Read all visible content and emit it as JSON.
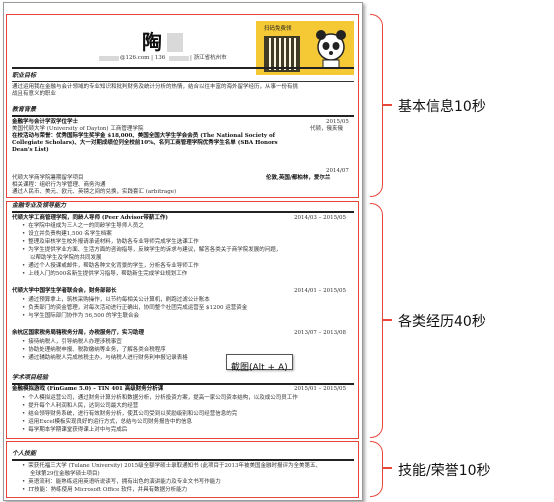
{
  "resume": {
    "name": "陶",
    "contact": "@126.com | 136",
    "contact_location": "| 浙江省杭州市",
    "ad_title": "扫码免费领",
    "sections": {
      "objective": {
        "title": "职业目标",
        "line1": "通过运用我在金融与会计领域的专业知识和批判财务及统计分析的热情，结合以往丰富的海外留学经历，从事一份有挑",
        "line2": "战且有意义的职业"
      },
      "education": {
        "title": "教育背景",
        "degree": "金融学与会计学双学位学士",
        "date": "2015/05",
        "school": "美国代顿大学 (University of Dayton) 工商管理学院",
        "location": "代顿，俄亥俄",
        "award": "在校活动与荣誉：优秀国际学生奖学金 $18,000、美国全国大学生学会会员 (The National Society of",
        "award2": "Collegiate Scholars)、大一对期成绩位列全校前10%、名列工商管理学院优秀学生名单 (SBA Honors",
        "award3": "Dean's List)",
        "exchange_date": "2014/07",
        "exchange": "代顿大学商学院暑期留学项目",
        "exchange_loc": "伦敦,英国/都柏林，爱尔兰",
        "ex_line1": "相关课程：组织行为学管理、商务沟通",
        "ex_line2": "通过人民币、美元、欧元、英镑之间的兑换，实践套汇 (arbitrage)"
      },
      "finance": {
        "title": "金融专业及领导能力",
        "job1": "代顿大学工商管理学院，同龄人导师 (Peer Advisor带薪工作)",
        "job1_date": "2014/03 – 2015/05",
        "job1_b": [
          "在学院中组成为三人之一的同龄学生导师人员之",
          "设立并负责构建1,500 名学生档案",
          "整理及审核学生校外报请承诺材料，协助各专业导师完成学生选课工作",
          "为学生提供学业方面、生活方面的咨询指导，反映学生的诉求与建议，解答各类关于商学院发展的问题，",
          "以帮助学生及学院的共同发展",
          "通过个人授课或邮件，帮助各种文化背景的学生，分析各专业导师工作",
          "上线入门的500名新生提供学习指导，帮助新生完成学业规划工作"
        ],
        "job2": "代顿大学中国学生学者联合会，财务部部长",
        "job2_date": "2014/01 – 2015/05",
        "job2_b": [
          "通过预算拿上，筑核采购操作，以节约每相关公计算机，刷跑过滤公计账本",
          "负责部门的资金管理，对每次活动进行正确出，协同整个社团完成运营至 $1200 运营资金",
          "与学生国际部门协作为 56,500 的学生联合会"
        ],
        "job3": "余杭区国家税务局辖税务分局，办税服务厅，实习助理",
        "job3_date": "2013/07 – 2013/08",
        "job3_b": [
          "接待纳税人，引导纳税人办理涉税事宜",
          "协助处理纳税申报、税款缴纳等业务，了解各类合税程序",
          "通过辅助纳税人完成核税主办，与纳税人进行财务利申报记录表格"
        ]
      },
      "academic": {
        "title": "学术项目经验",
        "proj": "金融模拟游戏 (FinGame 5.0) – TIN 401 高级财务分析课",
        "proj_date": "2015/01 – 2015/05",
        "proj_b": [
          "个人模拟运营公司，通过财务计算分析和数据分析，分析投资方案，提高一家公司资本结构，以及成公司员工作",
          "提升每个人利润和人民，达到公司最大的经营",
          "结合领导财务系统，进行有效财务分析，使其公司受到以奖励级别和公司经营信息的完",
          "运用Excel模板实现良好的运行方式，总结与公司财务报告中的信息",
          "每学期本学期课堂获得课上对中与完成后"
        ]
      },
      "personal": {
        "title": "个人技能",
        "b": [
          "荣获托福三大学 (Tulane University) 2015级全额学硕士录取通知书 (此项目于2013年被美国金融时报评为全美第五、",
          "全球第29位金融学硕士项目)",
          "英语流利：能熟练运用英语听说读写，拥有出色的演讲能力及专业文书写作能力",
          "IT技能：熟练使用 Microsoft Office 软件，并具有数据分析能力"
        ]
      }
    }
  },
  "screenshot_hint": "截图(Alt + A)",
  "labels": {
    "basic": "基本信息10秒",
    "experience": "各类经历40秒",
    "skills": "技能/荣誉10秒"
  },
  "colors": {
    "annotation": "#e8473c",
    "ad_bg": "#f5c936"
  }
}
